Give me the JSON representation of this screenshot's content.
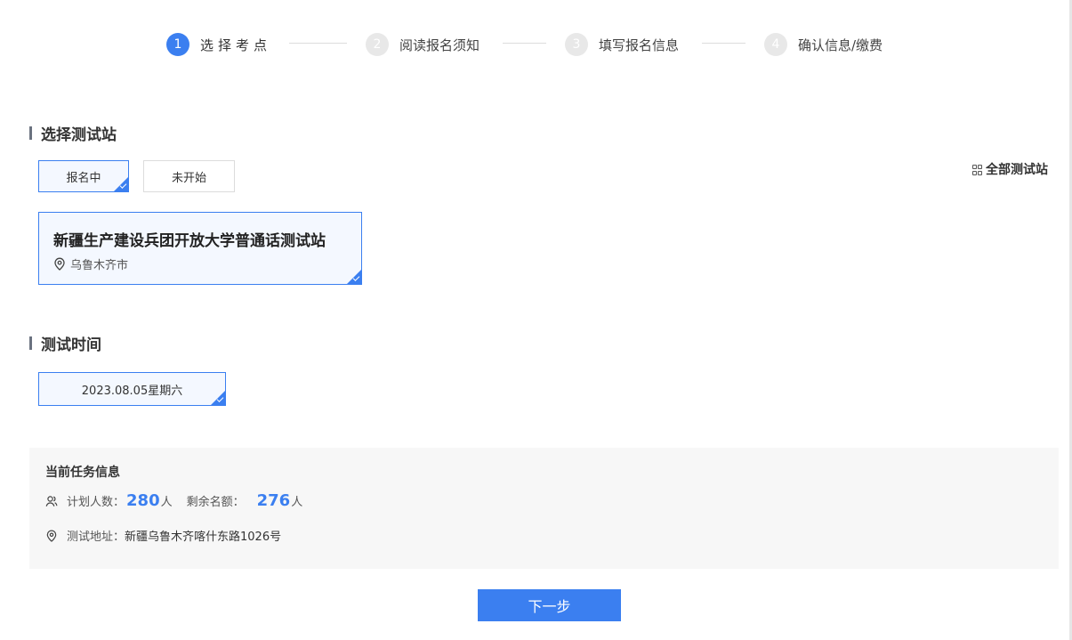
{
  "steps": [
    {
      "num": "1",
      "label": "选择考点"
    },
    {
      "num": "2",
      "label": "阅读报名须知"
    },
    {
      "num": "3",
      "label": "填写报名信息"
    },
    {
      "num": "4",
      "label": "确认信息/缴费"
    }
  ],
  "section_station": {
    "title": "选择测试站"
  },
  "filters": {
    "registering": "报名中",
    "not_started": "未开始"
  },
  "all_stations_link": "全部测试站",
  "station": {
    "name": "新疆生产建设兵团开放大学普通话测试站",
    "city": "乌鲁木齐市"
  },
  "section_time": {
    "title": "测试时间"
  },
  "date_option": "2023.08.05星期六",
  "task_info": {
    "title": "当前任务信息",
    "planned_label": "计划人数：",
    "planned_value": "280",
    "remaining_label": "剩余名额：",
    "remaining_value": "276",
    "unit": "人",
    "address_label": "测试地址：",
    "address_value": "新疆乌鲁木齐喀什东路1026号"
  },
  "next_button": "下一步",
  "colors": {
    "accent": "#3b7ff0",
    "panel_bg": "#f7f7f7",
    "selected_bg": "#f4f8ff"
  }
}
